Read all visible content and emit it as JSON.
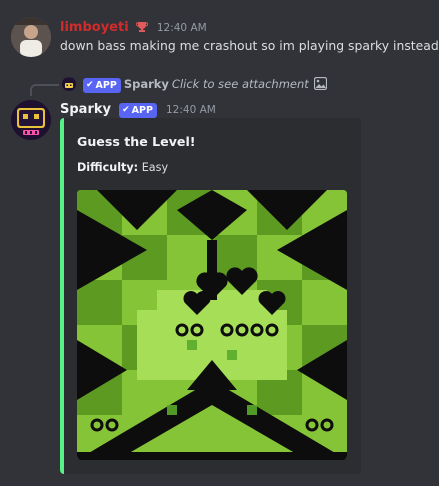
{
  "messages": [
    {
      "author": "limboyeti",
      "author_color": "#d12b2b",
      "role_icon": "trophy-icon",
      "time": "12:40 AM",
      "text": "down bass making me crashout so im playing sparky instead"
    },
    {
      "reply": {
        "author": "Sparky",
        "badge": "APP",
        "text": "Click to see attachment"
      },
      "author": "Sparky",
      "badge": "APP",
      "time": "12:40 AM",
      "embed": {
        "title": "Guess the Level!",
        "field_name": "Difficulty:",
        "field_value": "Easy",
        "accent_color": "#57f287"
      }
    }
  ]
}
